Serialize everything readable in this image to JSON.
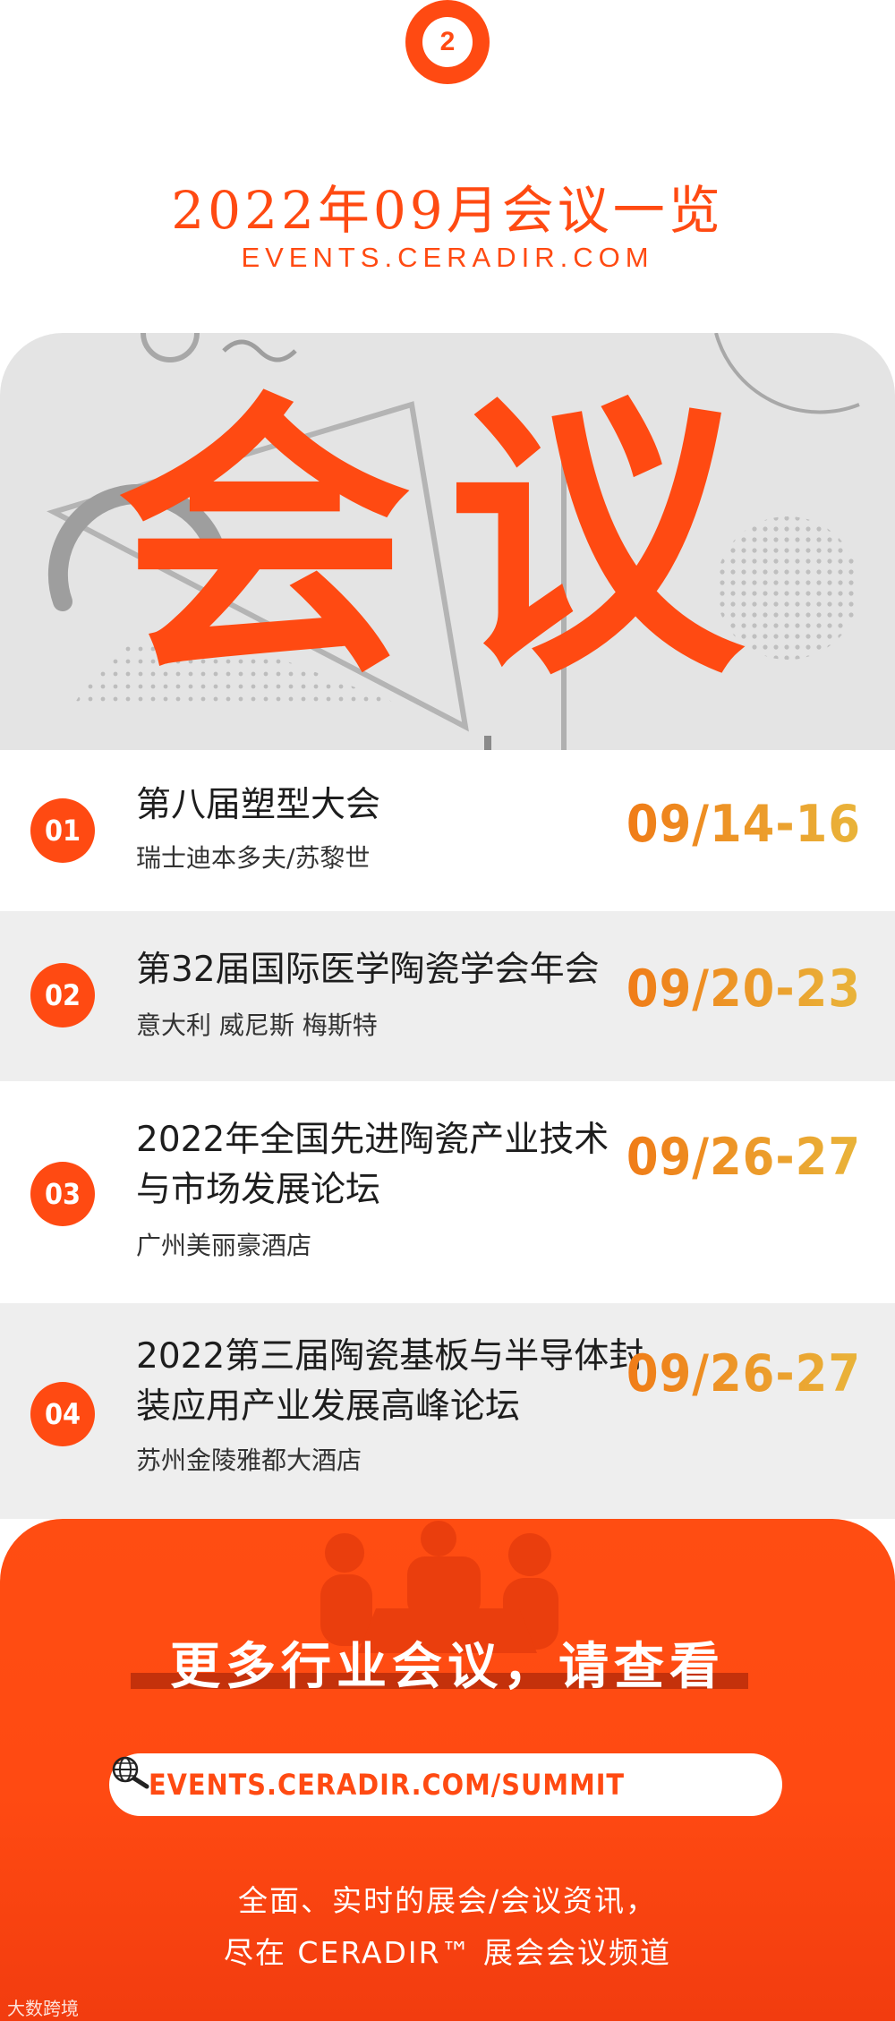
{
  "badge": {
    "number": "2"
  },
  "header": {
    "title": "2022年09月会议一览",
    "subtitle": "EVENTS.CERADIR.COM"
  },
  "hero": {
    "word": "会议"
  },
  "events": [
    {
      "num": "01",
      "title": "第八届塑型大会",
      "place": "瑞士迪本多夫/苏黎世",
      "date": "09/14-16"
    },
    {
      "num": "02",
      "title": "第32届国际医学陶瓷学会年会",
      "place": "意大利 威尼斯 梅斯特",
      "date": "09/20-23"
    },
    {
      "num": "03",
      "title": "2022年全国先进陶瓷产业技术与市场发展论坛",
      "place": "广州美丽豪酒店",
      "date": "09/26-27"
    },
    {
      "num": "04",
      "title": "2022第三届陶瓷基板与半导体封装应用产业发展高峰论坛",
      "place": "苏州金陵雅都大酒店",
      "date": "09/26-27"
    }
  ],
  "cta": {
    "heading": "更多行业会议，请查看",
    "url": "EVENTS.CERADIR.COM/SUMMIT",
    "search_icon": "globe-search-icon",
    "line1": "全面、实时的展会/会议资讯，",
    "line2": "尽在 CERADIR™ 展会会议频道"
  },
  "watermark": "大数跨境",
  "colors": {
    "accent": "#ff4a12",
    "date_start": "#f07a16",
    "date_end": "#e9b43a",
    "hero_bg": "#e4e4e4",
    "row_alt": "#eeeeee"
  }
}
